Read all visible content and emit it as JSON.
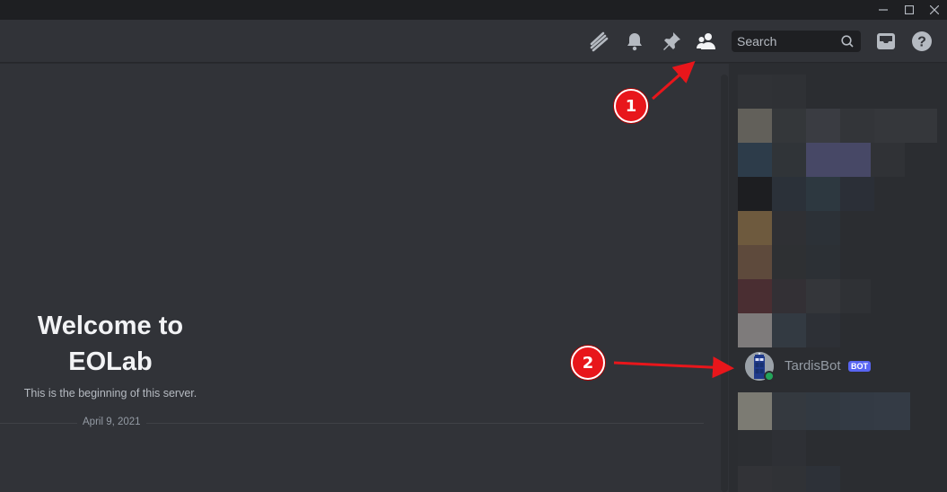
{
  "window_controls": {
    "minimize": "—",
    "maximize": "☐",
    "close": "✕"
  },
  "header": {
    "icons": [
      "threads-icon",
      "bell-icon",
      "pin-icon",
      "members-icon"
    ],
    "search": {
      "placeholder": "Search",
      "value": ""
    },
    "right_icons": [
      "inbox-icon",
      "help-icon"
    ]
  },
  "chat": {
    "welcome_title_line1": "Welcome to",
    "welcome_title_line2": "EOLab",
    "welcome_subtitle": "This is the beginning of this server.",
    "date_divider": "April 9, 2021"
  },
  "members": {
    "bot": {
      "name": "TardisBot",
      "tag": "BOT",
      "status": "online"
    }
  },
  "annotations": [
    {
      "number": "1"
    },
    {
      "number": "2"
    }
  ],
  "colors": {
    "accent": "#5865f2",
    "online": "#23a55a",
    "annotation": "#e8161b"
  }
}
